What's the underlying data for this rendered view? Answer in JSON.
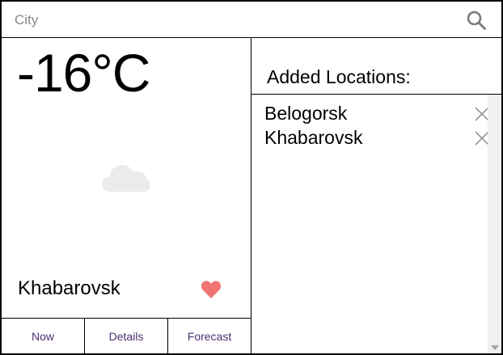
{
  "search": {
    "placeholder": "City",
    "value": ""
  },
  "current": {
    "temperature": "-16°C",
    "condition_icon": "cloud-icon",
    "city": "Khabarovsk",
    "favorite_icon": "heart-icon",
    "favorite": true
  },
  "tabs": [
    {
      "label": "Now"
    },
    {
      "label": "Details"
    },
    {
      "label": "Forecast"
    }
  ],
  "added": {
    "title": "Added Locations:",
    "locations": [
      {
        "name": "Belogorsk"
      },
      {
        "name": "Khabarovsk"
      }
    ]
  },
  "colors": {
    "tab_text": "#4b2f73",
    "heart": "#f07474",
    "cloud": "#ebebeb",
    "icon_gray": "#7a7a7a"
  }
}
